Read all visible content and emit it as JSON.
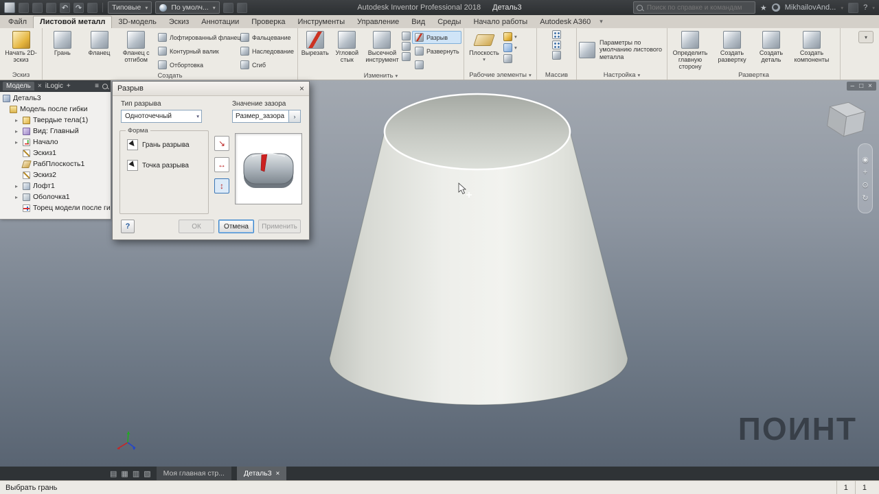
{
  "icons": {
    "close": "×",
    "dropdown": "▾",
    "chevron": "▸",
    "undo": "↶",
    "redo": "↷",
    "star": "★",
    "plus": "+",
    "question": "?",
    "hamburger": "≡",
    "minimize": "–",
    "restore": "□",
    "orbit": "↻",
    "target": "⊙",
    "dot": "◉",
    "pan": "+",
    "flip_diag": "↘",
    "flip_h": "↔",
    "flip_v": "↕",
    "more": "›",
    "grid1": "▤",
    "grid2": "▦",
    "grid3": "▥",
    "grid4": "▧"
  },
  "titlebar": {
    "styles_combo": "Типовые",
    "material_combo": "По умолч...",
    "app_title": "Autodesk Inventor Professional 2018",
    "doc_title": "Деталь3",
    "search_placeholder": "Поиск по справке и командам",
    "user_name": "MikhailovAnd..."
  },
  "tabs": {
    "t0": "Файл",
    "t1": "Листовой металл",
    "t2": "3D-модель",
    "t3": "Эскиз",
    "t4": "Аннотации",
    "t5": "Проверка",
    "t6": "Инструменты",
    "t7": "Управление",
    "t8": "Вид",
    "t9": "Среды",
    "t10": "Начало работы",
    "t11": "Autodesk A360"
  },
  "ribbon": {
    "sketch": {
      "start2d": "Начать 2D-эскиз",
      "label": "Эскиз"
    },
    "create": {
      "label": "Создать",
      "face": "Грань",
      "flange": "Фланец",
      "contour_flange": "Фланец с отгибом",
      "lofted_flange": "Лофтированный фланец",
      "contour_roll": "Контурный валик",
      "hem": "Отбортовка",
      "fold": "Фальцевание",
      "derive": "Наследование",
      "bend": "Сгиб"
    },
    "modify": {
      "label": "Изменить",
      "cut": "Вырезать",
      "corner_seam": "Угловой стык",
      "punch": "Высечной инструмент",
      "rip": "Разрыв",
      "unfold": "Развернуть"
    },
    "work": {
      "label": "Рабочие элементы",
      "plane": "Плоскость"
    },
    "pattern": {
      "label": "Массив"
    },
    "setup": {
      "label": "Настройка",
      "defaults": "Параметры по умолчанию листового металла"
    },
    "flat": {
      "label": "Развертка",
      "a_side": "Определить главную сторону",
      "flat_pattern": "Создать развертку",
      "make_part": "Создать деталь",
      "make_components": "Создать компоненты"
    }
  },
  "browser": {
    "model_tab": "Модель",
    "ilogic_tab": "iLogic",
    "root": "Деталь3",
    "i0": "Модель после гибки",
    "i1": "Твердые тела(1)",
    "i2": "Вид: Главный",
    "i3": "Начало",
    "i4": "Эскиз1",
    "i5": "РабПлоскость1",
    "i6": "Эскиз2",
    "i7": "Лофт1",
    "i8": "Оболочка1",
    "i9": "Торец модели после гибки"
  },
  "dialog": {
    "title": "Разрыв",
    "rip_type_label": "Тип разрыва",
    "rip_type_value": "Одноточечный",
    "gap_label": "Значение зазора",
    "gap_value": "Размер_зазора",
    "shape_label": "Форма",
    "rip_face": "Грань разрыва",
    "rip_point": "Точка разрыва",
    "ok": "ОК",
    "cancel": "Отмена",
    "apply": "Применить"
  },
  "dock": {
    "home_tab": "Моя главная стр...",
    "doc_tab": "Деталь3"
  },
  "statusbar": {
    "message": "Выбрать грань",
    "n1": "1",
    "n2": "1"
  },
  "watermark": "ПОИНТ"
}
